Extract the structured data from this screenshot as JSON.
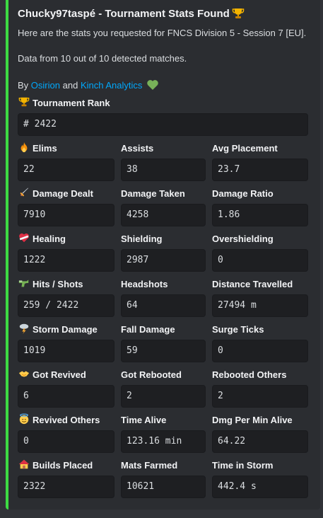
{
  "embed": {
    "accent_color": "#3ddc43",
    "title": "Chucky97taspé - Tournament Stats Found",
    "title_icon": "trophy-icon",
    "description_line1": "Here are the stats you requested for FNCS Division 5 - Session 7 [EU].",
    "description_line2": "Data from 10 out of 10 detected matches.",
    "by_prefix": "By",
    "author_link1": "Osirion",
    "and_text": "and",
    "author_link2": "Kinch Analytics",
    "heart_icon": "green-heart-icon",
    "rank": {
      "label": "Tournament Rank",
      "icon": "trophy-icon",
      "value": "# 2422"
    },
    "rows": [
      {
        "icon": "fire-icon",
        "fields": [
          {
            "label": "Elims",
            "value": "22"
          },
          {
            "label": "Assists",
            "value": "38"
          },
          {
            "label": "Avg Placement",
            "value": "23.7"
          }
        ]
      },
      {
        "icon": "dagger-icon",
        "fields": [
          {
            "label": "Damage Dealt",
            "value": "7910"
          },
          {
            "label": "Damage Taken",
            "value": "4258"
          },
          {
            "label": "Damage Ratio",
            "value": "1.86"
          }
        ]
      },
      {
        "icon": "mending-heart-icon",
        "fields": [
          {
            "label": "Healing",
            "value": "1222"
          },
          {
            "label": "Shielding",
            "value": "2987"
          },
          {
            "label": "Overshielding",
            "value": "0"
          }
        ]
      },
      {
        "icon": "water-pistol-icon",
        "fields": [
          {
            "label": "Hits / Shots",
            "value": "259 / 2422"
          },
          {
            "label": "Headshots",
            "value": "64"
          },
          {
            "label": "Distance Travelled",
            "value": "27494 m"
          }
        ]
      },
      {
        "icon": "storm-cloud-icon",
        "fields": [
          {
            "label": "Storm Damage",
            "value": "1019"
          },
          {
            "label": "Fall Damage",
            "value": "59"
          },
          {
            "label": "Surge Ticks",
            "value": "0"
          }
        ]
      },
      {
        "icon": "handshake-icon",
        "fields": [
          {
            "label": "Got Revived",
            "value": "6"
          },
          {
            "label": "Got Rebooted",
            "value": "2"
          },
          {
            "label": "Rebooted Others",
            "value": "2"
          }
        ]
      },
      {
        "icon": "halo-face-icon",
        "fields": [
          {
            "label": "Revived Others",
            "value": "0"
          },
          {
            "label": "Time Alive",
            "value": "123.16 min"
          },
          {
            "label": "Dmg Per Min Alive",
            "value": "64.22"
          }
        ]
      },
      {
        "icon": "house-icon",
        "fields": [
          {
            "label": "Builds Placed",
            "value": "2322"
          },
          {
            "label": "Mats Farmed",
            "value": "10621"
          },
          {
            "label": "Time in Storm",
            "value": "442.4 s"
          }
        ]
      }
    ]
  }
}
